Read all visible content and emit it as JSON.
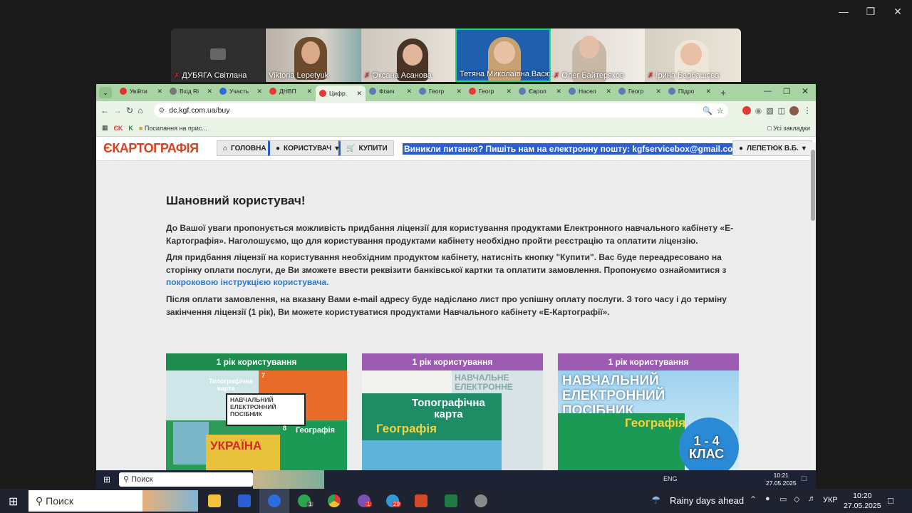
{
  "zoom": {
    "participants": [
      {
        "name": "ДУБЯГА Світлана",
        "muted": true
      },
      {
        "name": "Viktoria Lepetyuk",
        "muted": false
      },
      {
        "name": "Оксана Асанова",
        "muted": true
      },
      {
        "name": "Тетяна Миколаївна Васю...",
        "muted": false
      },
      {
        "name": "Олег Байтеряков",
        "muted": true
      },
      {
        "name": "Ірина Барбашова",
        "muted": true
      }
    ]
  },
  "browser": {
    "tabs": [
      {
        "label": "Увійти",
        "color": "#d33"
      },
      {
        "label": "Вхід Ri",
        "color": "#777"
      },
      {
        "label": "Участь",
        "color": "#2d6cdf"
      },
      {
        "label": "ДНВП",
        "color": "#e53935"
      },
      {
        "label": "Цифр.",
        "color": "#e53935"
      },
      {
        "label": "Фізич",
        "color": "#5b7bb4"
      },
      {
        "label": "Геогр",
        "color": "#5b7bb4"
      },
      {
        "label": "Геогр",
        "color": "#e53935"
      },
      {
        "label": "Європ",
        "color": "#5b7bb4"
      },
      {
        "label": "Насел",
        "color": "#5b7bb4"
      },
      {
        "label": "Геогр",
        "color": "#5b7bb4"
      },
      {
        "label": "Підро",
        "color": "#5b7bb4"
      }
    ],
    "url": "dc.kgf.com.ua/buy",
    "bookmark": "Посилання на прис...",
    "all_bookmarks": "Усі закладки",
    "bookmark_k": "ЄK"
  },
  "site": {
    "logo": "КАРТОГРАФІЯ",
    "logo_prefix": "Є",
    "nav_home": "ГОЛОВНА",
    "nav_user": "КОРИСТУВАЧ",
    "nav_buy": "КУПИТИ",
    "banner": "Виникли питання? Пишіть нам на електронну пошту: kgfservicebox@gmail.com",
    "account": "ЛЕПЕТЮК В.Б.",
    "heading": "Шановний користувач!",
    "p1": "До Вашої уваги пропонується можливість придбання ліцензії для користування продуктами Електронного навчального кабінету «Е-Картографія». Наголошуємо, що для користування продуктами кабінету необхідно пройти реєстрацію та оплатити ліцензію.",
    "p2_start": "Для придбання ліцензії на користування необхідним продуктом кабінету, натисніть кнопку \"Купити\". Вас буде переадресовано на сторінку оплати послуги, де Ви зможете ввести реквізити банківської картки та оплатити замовлення. Пропонуємо ознайомитися з ",
    "p2_link": "покроковою інструкцією користувача.",
    "p3": "Після оплати замовлення, на вказану Вами e-mail адресу буде надіслано лист про успішну оплату послуги. З того часу і до терміну закінчення ліцензії (1 рік), Ви можете користуватися продуктами Навчального кабінету «Е-Картографії».",
    "cards": [
      {
        "header": "1 рік користування",
        "color": "#1e8c4e",
        "lines": [
          "Топографічна",
          "карта",
          "НАВЧАЛЬНИЙ",
          "ЕЛЕКТРОННИЙ",
          "ПОСІБНИК",
          "УКРАЇНА",
          "Географія",
          "7",
          "8"
        ]
      },
      {
        "header": "1 рік користування",
        "color": "#9a5bb0",
        "lines": [
          "НАВЧАЛЬНЕ",
          "ЕЛЕКТРОННЕ",
          "Топографічна",
          "карта",
          "Географія"
        ]
      },
      {
        "header": "1 рік користування",
        "color": "#9a5bb0",
        "lines": [
          "НАВЧАЛЬНИЙ",
          "ЕЛЕКТРОННИЙ",
          "ПОСІБНИК",
          "Географія",
          "1 - 4",
          "КЛАС"
        ]
      }
    ]
  },
  "taskbar_inner": {
    "search": "Поиск",
    "time": "10:21",
    "date": "27.05.2025",
    "lang": "ENG"
  },
  "taskbar": {
    "search": "Поиск",
    "weather": "Rainy days ahead",
    "lang": "УКР",
    "time": "10:20",
    "date": "27.05.2025",
    "badges": {
      "telegram": "29",
      "viber": "1",
      "whatsapp": "1"
    }
  }
}
